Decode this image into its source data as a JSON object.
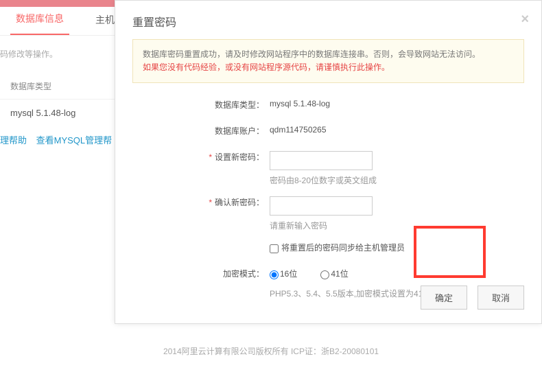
{
  "tabs": {
    "db_info": "数据库信息",
    "host_prefix": "主机"
  },
  "bg": {
    "note_suffix": "码修改等操作。",
    "section_label": "数据库类型",
    "db_type_value": "mysql 5.1.48-log",
    "link_help": "理帮助",
    "link_mysql": "查看MYSQL管理帮"
  },
  "modal": {
    "title": "重置密码",
    "alert1": "数据库密码重置成功，请及时修改网站程序中的数据库连接串。否则，会导致网站无法访问。",
    "alert2": "如果您没有代码经验，或没有网站程序源代码，请谨慎执行此操作。",
    "labels": {
      "db_type": "数据库类型：",
      "db_account": "数据库账户：",
      "new_pwd": "设置新密码：",
      "confirm_pwd": "确认新密码：",
      "enc_mode": "加密模式："
    },
    "values": {
      "db_type": "mysql 5.1.48-log",
      "db_account": "qdm114750265"
    },
    "hints": {
      "pwd_rule": "密码由8-20位数字或英文组成",
      "reenter": "请重新输入密码",
      "checkbox_label": "将重置后的密码同步给主机管理员",
      "enc_note": "PHP5.3、5.4、5.5版本,加密模式设置为41位"
    },
    "enc_options": {
      "opt16": "16位",
      "opt41": "41位"
    },
    "buttons": {
      "ok": "确定",
      "cancel": "取消"
    }
  },
  "footer": "2014阿里云计算有限公司版权所有 ICP证：浙B2-20080101"
}
